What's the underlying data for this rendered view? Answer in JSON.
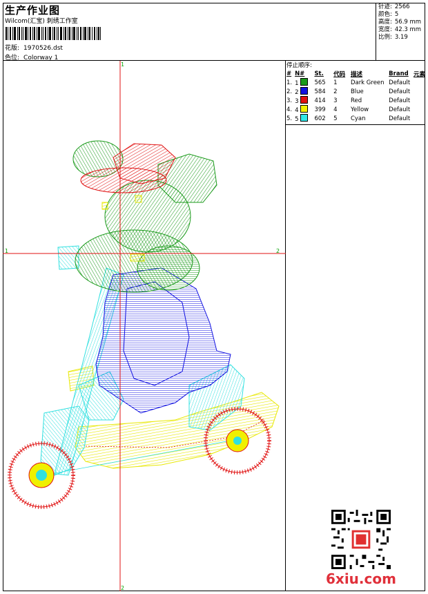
{
  "header": {
    "title": "生产作业图",
    "company": "Wilcom(汇宝) 刺绣工作室",
    "design_label": "花版:",
    "design_value": "1970526.dst",
    "colorway_label": "色位:",
    "colorway_value": "Colorway 1"
  },
  "stats": {
    "stitches_label": "针迹:",
    "stitches_value": "2566",
    "colors_label": "颜色:",
    "colors_value": "5",
    "height_label": "高度:",
    "height_value": "56.9 mm",
    "width_label": "宽度:",
    "width_value": "42.3 mm",
    "scale_label": "比例:",
    "scale_value": "3.19"
  },
  "legend": {
    "title": "停止顺序:",
    "headers": [
      "#",
      "N#",
      "St.",
      "代码",
      "描述",
      "Brand",
      "元素"
    ],
    "rows": [
      {
        "num": "1.",
        "n": "1",
        "st": "565",
        "code": "1",
        "desc": "Dark Green",
        "brand": "Default",
        "color": "#1a9a1a"
      },
      {
        "num": "2.",
        "n": "2",
        "st": "584",
        "code": "2",
        "desc": "Blue",
        "brand": "Default",
        "color": "#1010e0"
      },
      {
        "num": "3.",
        "n": "3",
        "st": "414",
        "code": "3",
        "desc": "Red",
        "brand": "Default",
        "color": "#e01010"
      },
      {
        "num": "4.",
        "n": "4",
        "st": "399",
        "code": "4",
        "desc": "Yellow",
        "brand": "Default",
        "color": "#f0f000"
      },
      {
        "num": "5.",
        "n": "5",
        "st": "602",
        "code": "5",
        "desc": "Cyan",
        "brand": "Default",
        "color": "#30e8e8"
      }
    ]
  },
  "axes": {
    "top": "1",
    "bottom": "2",
    "left": "1",
    "right": "2"
  },
  "watermark": {
    "site": "6xiu.com"
  }
}
